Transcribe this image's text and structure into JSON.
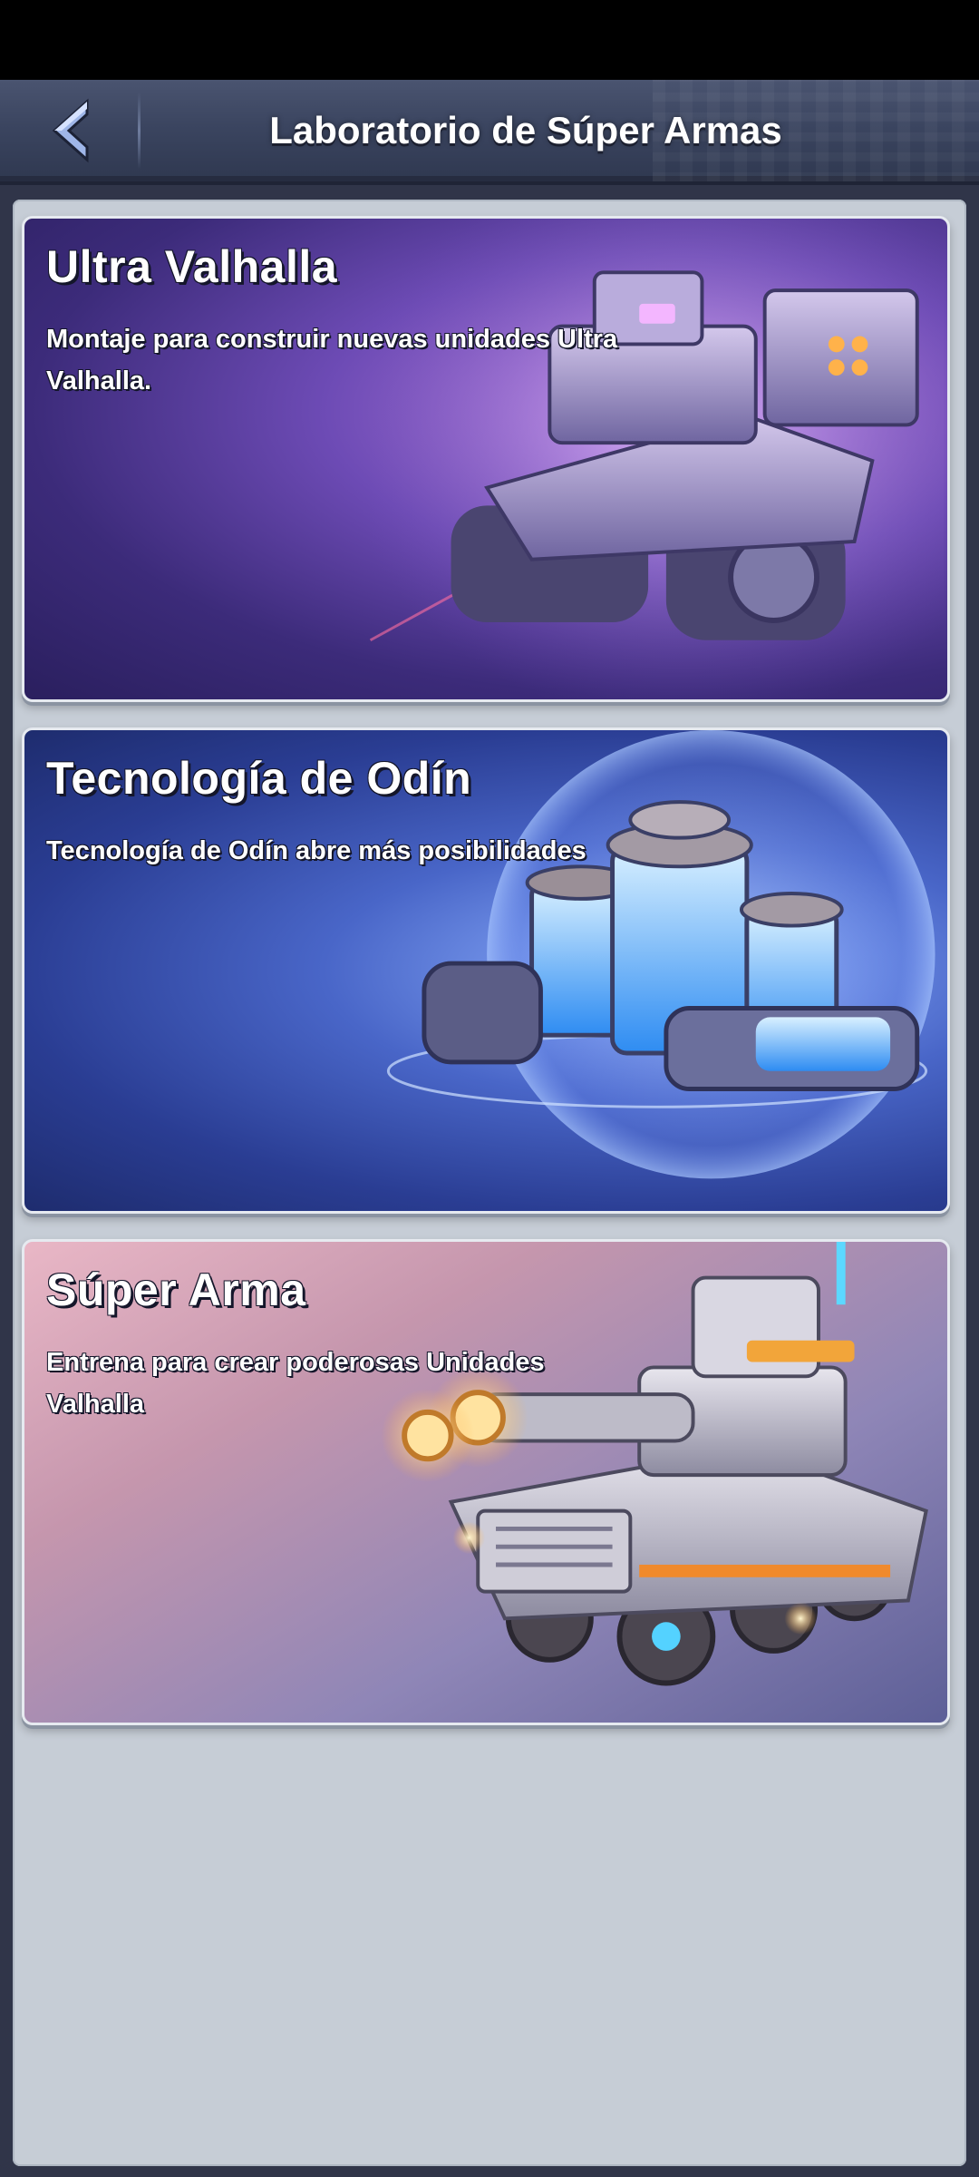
{
  "header": {
    "title": "Laboratorio de Súper Armas",
    "back_icon": "chevron-left-icon"
  },
  "cards": [
    {
      "title": "Ultra Valhalla",
      "description": "Montaje para construir nuevas unidades Ultra Valhalla.",
      "art": "ultra-valhalla-tank-art",
      "accent": "#7a55c8"
    },
    {
      "title": "Tecnología de Odín",
      "description": "Tecnología de Odín abre más posibilidades",
      "art": "odin-tech-canisters-art",
      "accent": "#4b6fd0"
    },
    {
      "title": "Súper Arma",
      "description": "Entrena para crear poderosas Unidades Valhalla",
      "art": "super-weapon-armored-vehicle-art",
      "accent": "#f0a040"
    }
  ],
  "colors": {
    "header_bg": "#3b4560",
    "panel_bg": "#c6cdd6",
    "status_bar": "#000000"
  }
}
